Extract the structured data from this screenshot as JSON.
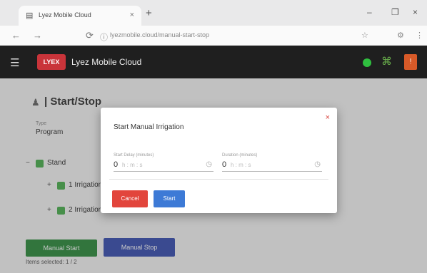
{
  "browser": {
    "tab_title": "Lyez Mobile Cloud",
    "tab_icon": "page-icon",
    "new_tab": "+",
    "url": "lyezmobile.cloud/manual-start-stop",
    "controls": {
      "minimize": "–",
      "maximize": "❐",
      "close": "×"
    }
  },
  "appbar": {
    "menu_icon": "☰",
    "logo_text": "LYEX",
    "title": "Lyez Mobile Cloud",
    "status_color": "#2fbf3f",
    "alert_glyph": "!"
  },
  "page": {
    "title": "| Start/Stop",
    "field_label": "Type",
    "field_value": "Program",
    "tree": [
      {
        "toggle": "−",
        "label": "Stand"
      },
      {
        "toggle": "+",
        "label": "1 Irrigation"
      },
      {
        "toggle": "+",
        "label": "2 Irrigation"
      }
    ],
    "buttons": {
      "start": "Manual Start",
      "stop": "Manual Stop"
    },
    "footer": "Items selected: 1 / 2"
  },
  "modal": {
    "title": "Start Manual Irrigation",
    "close": "×",
    "fields": [
      {
        "label": "Start Delay (minutes)",
        "value": "0",
        "placeholder": "h : m : s"
      },
      {
        "label": "Duration (minutes)",
        "value": "0",
        "placeholder": "h : m : s"
      }
    ],
    "buttons": {
      "cancel": "Cancel",
      "start": "Start"
    }
  },
  "colors": {
    "appbar": "#1f1f1f",
    "logo": "#c9343a",
    "start_green": "#2e8b3e",
    "stop_blue": "#3a4fb0",
    "cancel_red": "#e2453c",
    "modal_start_blue": "#3d7ad6"
  }
}
